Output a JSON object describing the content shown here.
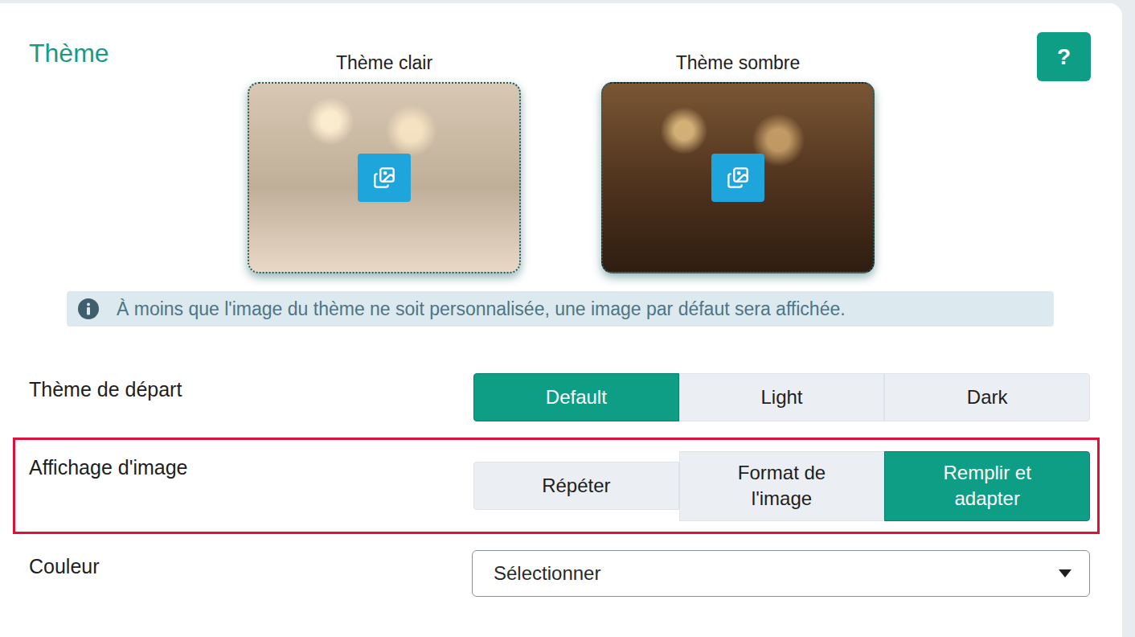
{
  "section": {
    "title": "Thème",
    "help": "?"
  },
  "previews": [
    {
      "label": "Thème clair",
      "kind": "light"
    },
    {
      "label": "Thème sombre",
      "kind": "dark"
    }
  ],
  "info": "À moins que l'image du thème ne soit personnalisée, une image par défaut sera affichée.",
  "settings": [
    {
      "label": "Thème de départ",
      "kind": "segmented",
      "highlighted": false,
      "options": [
        {
          "label": "Default",
          "selected": true
        },
        {
          "label": "Light",
          "selected": false
        },
        {
          "label": "Dark",
          "selected": false
        }
      ]
    },
    {
      "label": "Affichage d'image",
      "kind": "segmented",
      "highlighted": true,
      "options": [
        {
          "label": "Répéter",
          "selected": false
        },
        {
          "label": "Format de l'image",
          "selected": false
        },
        {
          "label": "Remplir et adapter",
          "selected": true
        }
      ]
    },
    {
      "label": "Couleur",
      "kind": "select",
      "highlighted": false,
      "value": "Sélectionner"
    }
  ]
}
